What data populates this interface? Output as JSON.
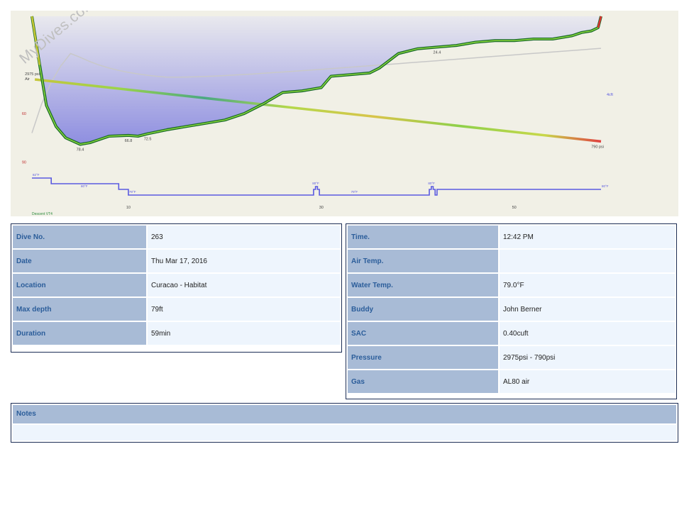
{
  "watermark": "MyDives.com",
  "chart_data": {
    "type": "line",
    "title": "",
    "x_unit": "min",
    "xlim": [
      0,
      59
    ],
    "depth_ylim": [
      0,
      95
    ],
    "x_ticks": [
      {
        "value": 10,
        "label": "10"
      },
      {
        "value": 30,
        "label": "30"
      },
      {
        "value": 50,
        "label": "50"
      }
    ],
    "depth_ticks": [
      {
        "value": 60,
        "label": "60"
      },
      {
        "value": 90,
        "label": "90"
      }
    ],
    "depth_series": {
      "name": "Depth",
      "x": [
        0,
        0.8,
        1.5,
        2.5,
        3.5,
        5,
        6,
        7,
        8,
        10,
        11,
        12,
        14,
        16,
        18,
        20,
        22,
        24,
        26,
        28,
        30,
        31,
        33,
        35,
        36,
        38,
        40,
        42,
        44,
        46,
        48,
        50,
        52,
        54,
        56,
        57,
        58,
        58.7,
        59
      ],
      "y": [
        0,
        30,
        55,
        68,
        75,
        79,
        78,
        76,
        74,
        73.5,
        74,
        72.5,
        70,
        68,
        66,
        64,
        60,
        54,
        47,
        46,
        44,
        37,
        36,
        35,
        32,
        23,
        20,
        19,
        18,
        16,
        15,
        15,
        14,
        14,
        12,
        10,
        9,
        7,
        0
      ],
      "labels": [
        {
          "x": 5,
          "y": 79,
          "text": "78.4"
        },
        {
          "x": 10,
          "y": 73.5,
          "text": "66.8"
        },
        {
          "x": 12,
          "y": 72.5,
          "text": "72.5"
        },
        {
          "x": 42,
          "y": 19,
          "text": "24.4"
        }
      ]
    },
    "pressure_series": {
      "name": "Air",
      "unit": "psi",
      "x": [
        0.3,
        59
      ],
      "y": [
        2975,
        790
      ],
      "start_label": "2975 psi",
      "end_label": "790 psi"
    },
    "gas_label": "Air",
    "ndl_label": "4cft",
    "temperature_series": {
      "name": "Temperature",
      "x": [
        0,
        2,
        9,
        10,
        29,
        29.2,
        29.4,
        29.6,
        29.8,
        41,
        41.2,
        41.4,
        41.6,
        41.8,
        42,
        59
      ],
      "y": [
        82,
        81,
        80,
        79,
        79,
        80,
        80.5,
        80,
        79,
        79,
        80,
        80.5,
        80,
        79,
        80,
        80
      ],
      "labels": [
        {
          "x": 0,
          "y": 82,
          "text": "82°F"
        },
        {
          "x": 5,
          "y": 80,
          "text": "80°F"
        },
        {
          "x": 10,
          "y": 79,
          "text": "79°F"
        },
        {
          "x": 29,
          "y": 80.5,
          "text": "80°F"
        },
        {
          "x": 33,
          "y": 79,
          "text": "79°F"
        },
        {
          "x": 41,
          "y": 80.5,
          "text": "80°F"
        },
        {
          "x": 59,
          "y": 80,
          "text": "80°F"
        }
      ]
    },
    "device_label": "Descent VT4"
  },
  "left_panel": {
    "rows": [
      {
        "label": "Dive No.",
        "value": "263"
      },
      {
        "label": "Date",
        "value": "Thu Mar 17, 2016"
      },
      {
        "label": "Location",
        "value": "Curacao - Habitat"
      },
      {
        "label": "Max depth",
        "value": "79ft"
      },
      {
        "label": "Duration",
        "value": "59min"
      }
    ]
  },
  "right_panel": {
    "rows": [
      {
        "label": "Time.",
        "value": "12:42 PM"
      },
      {
        "label": "Air Temp.",
        "value": ""
      },
      {
        "label": "Water Temp.",
        "value": "79.0°F"
      },
      {
        "label": "Buddy",
        "value": "John Berner"
      },
      {
        "label": "SAC",
        "value": "0.40cuft"
      },
      {
        "label": "Pressure",
        "value": "2975psi - 790psi"
      },
      {
        "label": "Gas",
        "value": "AL80 air"
      }
    ]
  },
  "notes": {
    "label": "Notes",
    "value": ""
  },
  "colors": {
    "chart_bg": "#f1f0e6",
    "depth_fill_top": "#e9e9ee",
    "depth_fill_bottom": "#8e8ee0",
    "depth_line": "#1a6b2a",
    "depth_line_highlight": "#8fdc3c",
    "pressure_line": "#b8d84a",
    "pressure_accent": "#3a9a6a",
    "temperature_line": "#5a5ae0",
    "ceiling_line": "#c8c8c8",
    "label_blue": "#2b5d9a",
    "header_bg": "#a8bbd6"
  }
}
